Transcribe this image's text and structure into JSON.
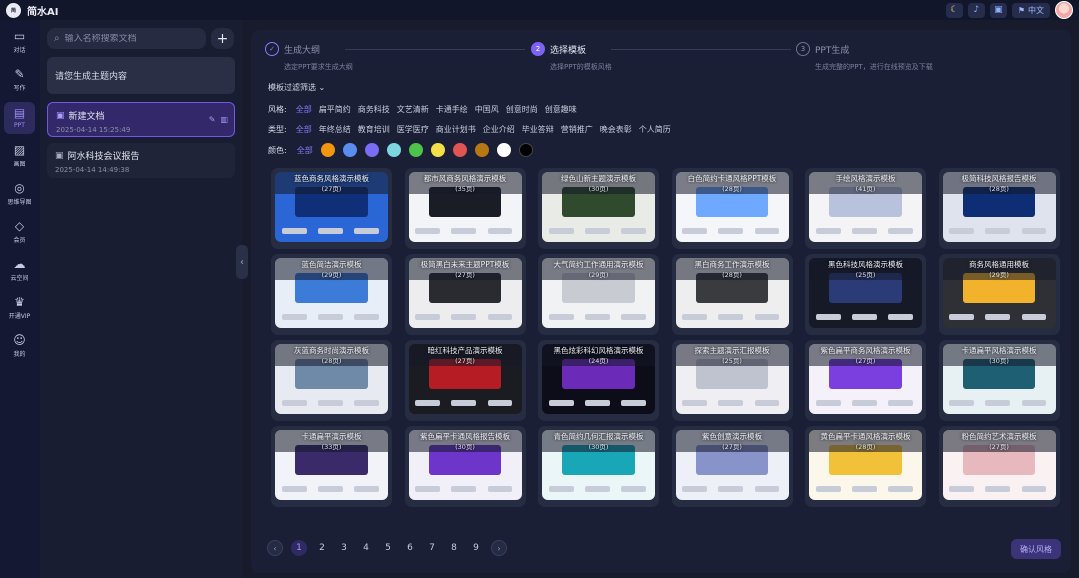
{
  "app": {
    "logo_badge": "简",
    "name": "简水AI"
  },
  "topbar": {
    "lang_label": "中文",
    "icons": [
      "moon-icon",
      "bell-icon",
      "gift-icon",
      "language-icon"
    ]
  },
  "rail": {
    "items": [
      {
        "label": "对话",
        "icon": "chat-icon"
      },
      {
        "label": "写作",
        "icon": "pen-icon"
      },
      {
        "label": "PPT",
        "icon": "ppt-icon",
        "active": true
      },
      {
        "label": "画图",
        "icon": "image-icon"
      },
      {
        "label": "思维导图",
        "icon": "mindmap-icon"
      },
      {
        "label": "会员",
        "icon": "diamond-icon"
      },
      {
        "label": "云空间",
        "icon": "cloud-icon"
      },
      {
        "label": "开通VIP",
        "icon": "crown-icon"
      },
      {
        "label": "我的",
        "icon": "user-icon"
      }
    ]
  },
  "sidebar": {
    "search_placeholder": "输入名称搜索文档",
    "new_doc_label": "请您生成主题内容",
    "docs": [
      {
        "title": "新建文档",
        "date": "2025-04-14 15:25:49",
        "active": true
      },
      {
        "title": "阿水科技会议报告",
        "date": "2025-04-14 14:49:38",
        "active": false
      }
    ]
  },
  "steps": [
    {
      "num": "✓",
      "title": "生成大纲",
      "desc": "选定PPT要求生成大纲",
      "state": "done"
    },
    {
      "num": "2",
      "title": "选择模板",
      "desc": "选择PPT的模板风格",
      "state": "active"
    },
    {
      "num": "3",
      "title": "PPT生成",
      "desc": "生成完整的PPT，进行在线预览及下载",
      "state": "todo"
    }
  ],
  "filters": {
    "heading": "模板过滤筛选 ⌄",
    "style_label": "风格:",
    "styles": [
      "全部",
      "扁平简约",
      "商务科技",
      "文艺清新",
      "卡通手绘",
      "中国风",
      "创意时尚",
      "创意趣味"
    ],
    "type_label": "类型:",
    "types": [
      "全部",
      "年终总结",
      "教育培训",
      "医学医疗",
      "商业计划书",
      "企业介绍",
      "毕业答辩",
      "营销推广",
      "晚会表彰",
      "个人简历"
    ],
    "color_label": "颜色:",
    "color_all": "全部",
    "colors": [
      "#f0960f",
      "#5b8def",
      "#7a6cf5",
      "#7ad6df",
      "#4cc44a",
      "#f2df4a",
      "#e05454",
      "#b77814",
      "#ffffff",
      "#000000"
    ]
  },
  "templates": [
    {
      "title": "蓝色商务风格演示模板",
      "pages": "(27页)",
      "bg": "#2a66d6",
      "hero": "#0f2f78"
    },
    {
      "title": "都市风商务风格演示模板",
      "pages": "(35页)",
      "bg": "#f3f4f7",
      "hero": "#1b1d26"
    },
    {
      "title": "绿色山新主题演示模板",
      "pages": "(30页)",
      "bg": "#e9ece6",
      "hero": "#2f4a2d"
    },
    {
      "title": "白色简约卡通风格PPT模板",
      "pages": "(28页)",
      "bg": "#f5f6fa",
      "hero": "#6fa8ff"
    },
    {
      "title": "手绘风格演示模板",
      "pages": "(41页)",
      "bg": "#f4f4f6",
      "hero": "#b9c2dc"
    },
    {
      "title": "极简科技风格报告模板",
      "pages": "(28页)",
      "bg": "#dfe3ee",
      "hero": "#0d2e74"
    },
    {
      "title": "蓝色简洁演示模板",
      "pages": "(29页)",
      "bg": "#e7eef8",
      "hero": "#3c7bd8"
    },
    {
      "title": "极简黑白未来主题PPT模板",
      "pages": "(27页)",
      "bg": "#ededf0",
      "hero": "#2a2b31"
    },
    {
      "title": "大气简约工作通用演示模板",
      "pages": "(29页)",
      "bg": "#f1f2f4",
      "hero": "#c9cbd3"
    },
    {
      "title": "黑白商务工作演示模板",
      "pages": "(28页)",
      "bg": "#eeeeee",
      "hero": "#3a3b3e"
    },
    {
      "title": "黑色科技风格演示模板",
      "pages": "(25页)",
      "bg": "#161a26",
      "hero": "#2a3b78"
    },
    {
      "title": "商务风格通用模板",
      "pages": "(29页)",
      "bg": "#2f3035",
      "hero": "#f2b22c"
    },
    {
      "title": "灰蓝商务时尚演示模板",
      "pages": "(28页)",
      "bg": "#e7eaf0",
      "hero": "#6f8aa8"
    },
    {
      "title": "暗红科技产品演示模板",
      "pages": "(27页)",
      "bg": "#1b1c21",
      "hero": "#b51c23"
    },
    {
      "title": "黑色炫彩科幻风格演示模板",
      "pages": "(24页)",
      "bg": "#0c0d18",
      "hero": "#6b2bb8"
    },
    {
      "title": "探索主题演示汇报模板",
      "pages": "(25页)",
      "bg": "#efeff3",
      "hero": "#bfc3cf"
    },
    {
      "title": "紫色扁平商务风格演示模板",
      "pages": "(27页)",
      "bg": "#f4f1fb",
      "hero": "#7b3fe0"
    },
    {
      "title": "卡通扁平风格演示模板",
      "pages": "(30页)",
      "bg": "#e7f1f3",
      "hero": "#1f5f73"
    },
    {
      "title": "卡通扁平演示模板",
      "pages": "(33页)",
      "bg": "#f2f3f8",
      "hero": "#3a2a6a"
    },
    {
      "title": "紫色扁平卡通风格报告模板",
      "pages": "(30页)",
      "bg": "#f1eff8",
      "hero": "#6d35c9"
    },
    {
      "title": "青色简约几何汇报演示模板",
      "pages": "(30页)",
      "bg": "#eaf6f7",
      "hero": "#19a7b8"
    },
    {
      "title": "紫色创意演示模板",
      "pages": "(27页)",
      "bg": "#eef0f8",
      "hero": "#8893c9"
    },
    {
      "title": "黄色扁平卡通风格演示模板",
      "pages": "(28页)",
      "bg": "#fbf7ea",
      "hero": "#f1c13a"
    },
    {
      "title": "粉色简约艺术演示模板",
      "pages": "(27页)",
      "bg": "#f9f1f2",
      "hero": "#e7b9bf"
    }
  ],
  "pagination": {
    "prev": "‹",
    "next": "›",
    "pages": [
      "1",
      "2",
      "3",
      "4",
      "5",
      "6",
      "7",
      "8",
      "9"
    ],
    "current": "1"
  },
  "confirm_label": "确认风格"
}
